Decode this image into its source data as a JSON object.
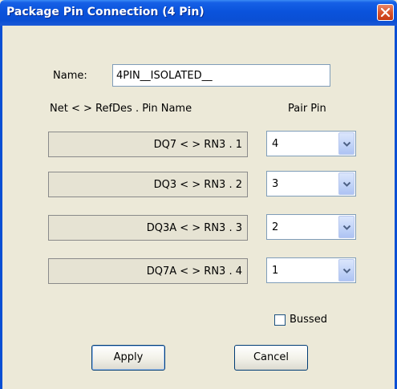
{
  "window": {
    "title": "Package Pin Connection (4 Pin)"
  },
  "form": {
    "name_label": "Name:",
    "name_value": "4PIN__ISOLATED__",
    "header_left": "Net < > RefDes . Pin Name",
    "header_right": "Pair Pin"
  },
  "pins": [
    {
      "label": "DQ7 < > RN3 . 1",
      "pair": "4"
    },
    {
      "label": "DQ3 < > RN3 . 2",
      "pair": "3"
    },
    {
      "label": "DQ3A < > RN3 . 3",
      "pair": "2"
    },
    {
      "label": "DQ7A < > RN3 . 4",
      "pair": "1"
    }
  ],
  "bussed": {
    "label": "Bussed",
    "checked": false
  },
  "buttons": {
    "apply": "Apply",
    "cancel": "Cancel"
  },
  "icons": {
    "close": "close-icon",
    "dropdown": "chevron-down-icon"
  },
  "colors": {
    "titlebar": "#0a4fd4",
    "dialog_bg": "#ece9d8",
    "close": "#d9542c"
  }
}
